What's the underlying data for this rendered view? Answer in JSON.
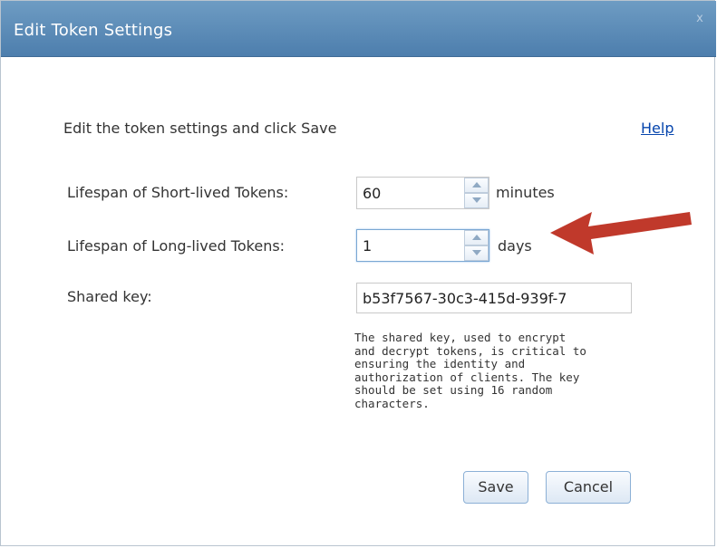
{
  "dialog": {
    "title": "Edit Token Settings",
    "close_glyph": "x"
  },
  "instruction": "Edit the token settings and click Save",
  "help_link": "Help",
  "short_lived": {
    "label": "Lifespan of Short-lived Tokens:",
    "value": "60",
    "unit": "minutes"
  },
  "long_lived": {
    "label": "Lifespan of Long-lived Tokens:",
    "value": "1",
    "unit": "days"
  },
  "shared_key": {
    "label": "Shared key:",
    "value": "b53f7567-30c3-415d-939f-7",
    "help_lines": [
      "The shared key, used to encrypt",
      "and decrypt tokens, is critical to",
      "ensuring the identity and",
      "authorization of clients. The key",
      "should be set using 16 random",
      "characters."
    ]
  },
  "buttons": {
    "save": "Save",
    "cancel": "Cancel"
  },
  "colors": {
    "titlebar": "#5b89b6",
    "link": "#0645ad",
    "annotation_arrow": "#c0392b"
  },
  "annotation": {
    "icon": "red-arrow-pointing-left"
  }
}
